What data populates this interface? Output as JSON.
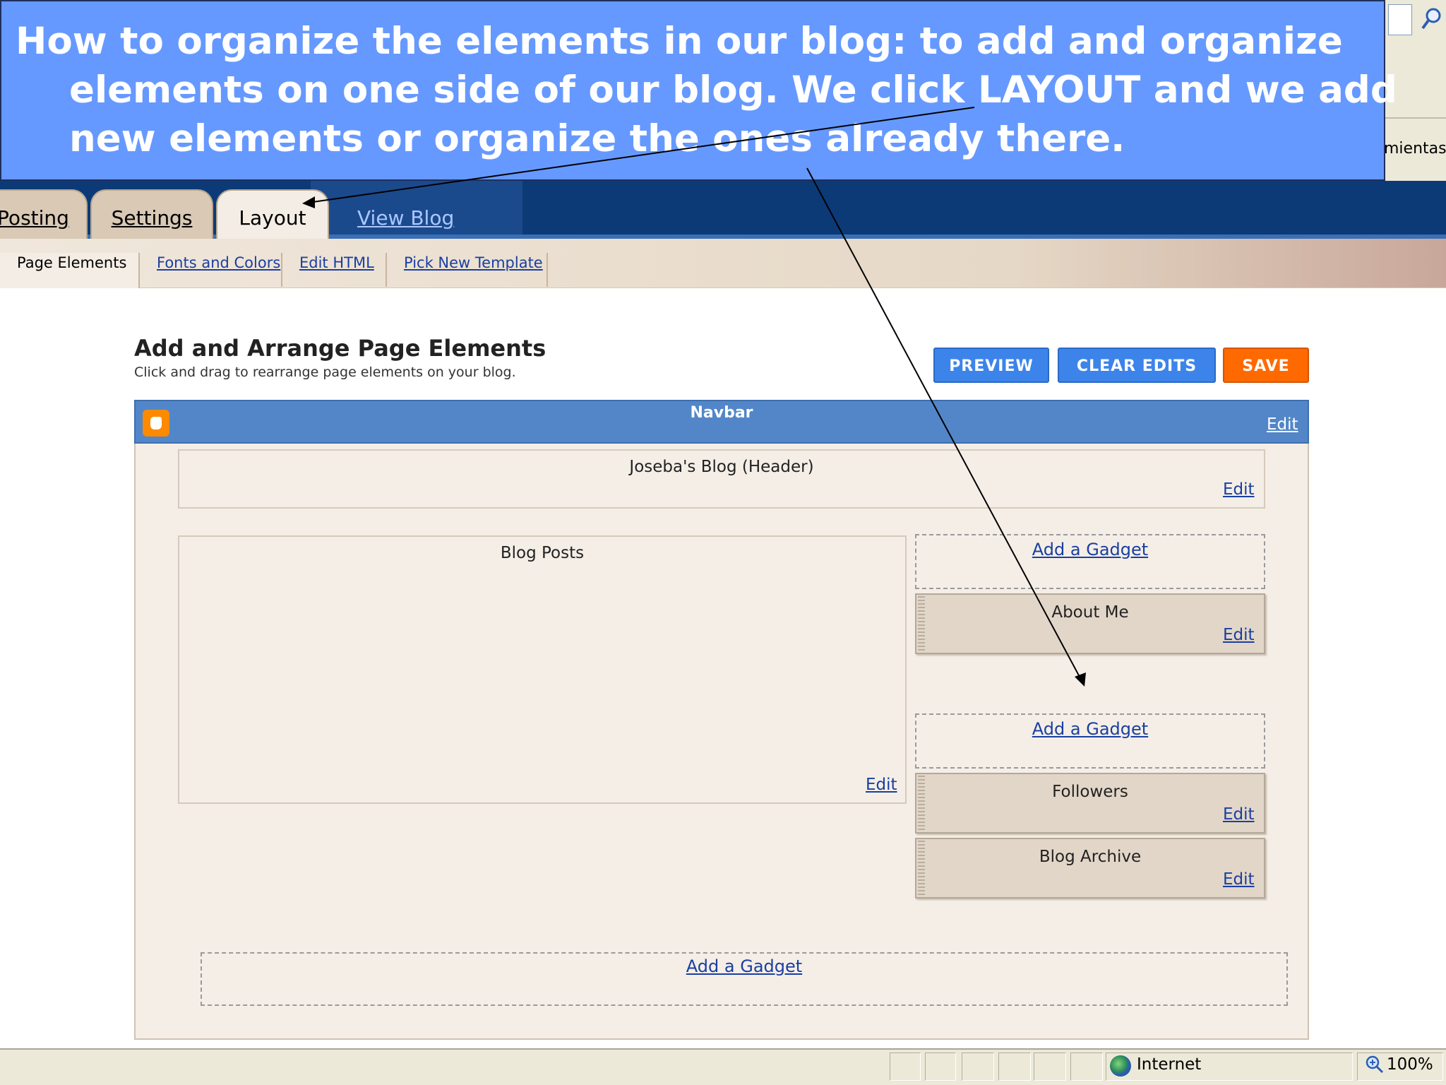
{
  "overlay": {
    "lines": [
      "How to organize the elements in our blog: to add and organize",
      "elements on one side of our blog. We click LAYOUT and we add",
      "new elements or organize the ones already there."
    ]
  },
  "browser": {
    "tools_label_partial": "mientas",
    "status": {
      "zone": "Internet",
      "zoom": "100%"
    }
  },
  "tabs": {
    "posting": "Posting",
    "settings": "Settings",
    "layout": "Layout",
    "view_blog": "View Blog"
  },
  "subtabs": {
    "page_elements": "Page Elements",
    "fonts_colors": "Fonts and Colors",
    "edit_html": "Edit HTML",
    "pick_template": "Pick New Template"
  },
  "page": {
    "title": "Add and Arrange Page Elements",
    "subtitle": "Click and drag to rearrange page elements on your blog."
  },
  "buttons": {
    "preview": "PREVIEW",
    "clear_edits": "CLEAR EDITS",
    "save": "SAVE"
  },
  "layout": {
    "navbar_title": "Navbar",
    "header_title": "Joseba's Blog (Header)",
    "blog_posts_title": "Blog Posts",
    "edit_label": "Edit",
    "add_gadget_label": "Add a Gadget",
    "sidebar_widgets": [
      "About Me",
      "Followers",
      "Blog Archive"
    ]
  },
  "colors": {
    "overlay_bg": "#6699ff",
    "tab_bar": "#0c3a77",
    "navbar": "#5286c8",
    "save_button": "#ff6a00",
    "blue_button": "#3d84ea",
    "link": "#1a3fa0"
  },
  "icons": [
    "search-icon",
    "blogger-icon",
    "globe-icon",
    "zoom-icon"
  ]
}
